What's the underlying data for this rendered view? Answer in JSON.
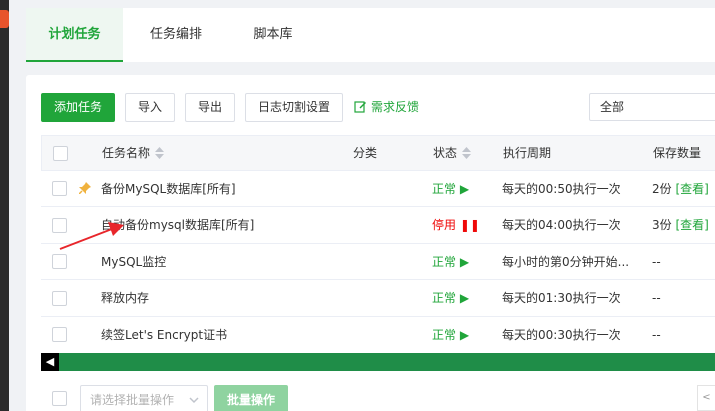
{
  "tabs": [
    {
      "label": "计划任务",
      "active": true
    },
    {
      "label": "任务编排",
      "active": false
    },
    {
      "label": "脚本库",
      "active": false
    }
  ],
  "toolbar": {
    "add_label": "添加任务",
    "import_label": "导入",
    "export_label": "导出",
    "log_cut_label": "日志切割设置",
    "feedback_label": "需求反馈",
    "filter_value": "全部"
  },
  "table": {
    "headers": {
      "name": "任务名称",
      "category": "分类",
      "status": "状态",
      "cycle": "执行周期",
      "save_count": "保存数量"
    },
    "rows": [
      {
        "name": "备份MySQL数据库[所有]",
        "status": "正常",
        "cycle": "每天的00:50执行一次",
        "save": "2份",
        "save_link": "[查看]",
        "pinned": true
      },
      {
        "name": "自动备份mysql数据库[所有]",
        "status": "停用",
        "cycle": "每天的04:00执行一次",
        "save": "3份",
        "save_link": "[查看]",
        "pinned": false
      },
      {
        "name": "MySQL监控",
        "status": "正常",
        "cycle": "每小时的第0分钟开始...",
        "save": "--",
        "save_link": "",
        "pinned": false
      },
      {
        "name": "释放内存",
        "status": "正常",
        "cycle": "每天的01:30执行一次",
        "save": "--",
        "save_link": "",
        "pinned": false
      },
      {
        "name": "续签Let's Encrypt证书",
        "status": "正常",
        "cycle": "每天的00:30执行一次",
        "save": "--",
        "save_link": "",
        "pinned": false
      }
    ]
  },
  "footer": {
    "batch_placeholder": "请选择批量操作",
    "batch_button": "批量操作"
  },
  "colors": {
    "accent": "#20a53a",
    "stopped": "#ef0808",
    "annotation_arrow": "#e8262b"
  }
}
